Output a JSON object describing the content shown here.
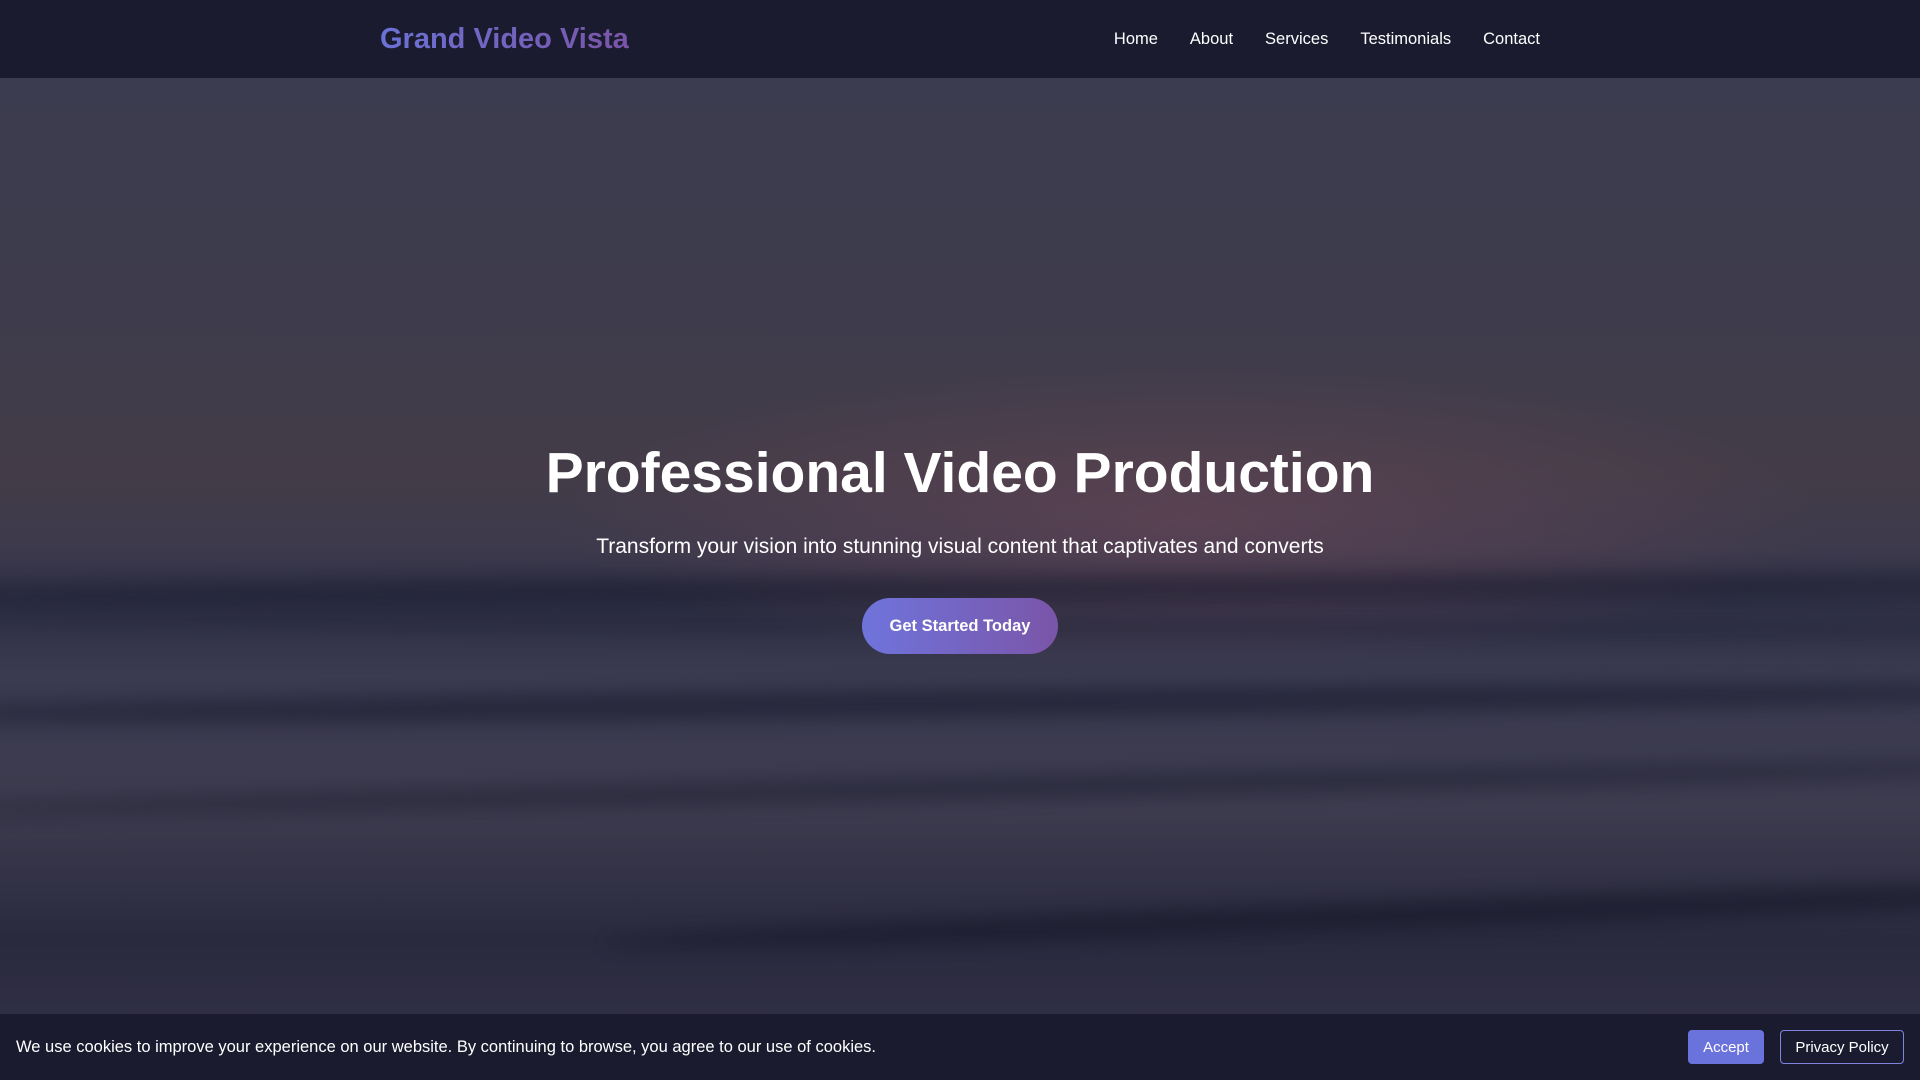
{
  "brand": {
    "name": "Grand Video Vista",
    "gradient_start": "#6b72d6",
    "gradient_end": "#7a55a8"
  },
  "nav": {
    "items": [
      {
        "label": "Home"
      },
      {
        "label": "About"
      },
      {
        "label": "Services"
      },
      {
        "label": "Testimonials"
      },
      {
        "label": "Contact"
      }
    ]
  },
  "hero": {
    "title": "Professional Video Production",
    "subtitle": "Transform your vision into stunning visual content that captivates and converts",
    "cta_label": "Get Started Today"
  },
  "cookie_banner": {
    "message": "We use cookies to improve your experience on our website. By continuing to browse, you agree to our use of cookies.",
    "accept_label": "Accept",
    "privacy_label": "Privacy Policy",
    "accent_color": "#6a72dc"
  }
}
